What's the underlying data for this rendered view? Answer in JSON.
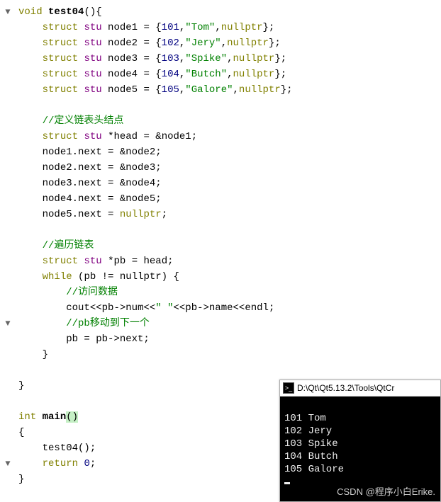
{
  "code": {
    "funcDecl": {
      "ret": "void",
      "name": "test04",
      "params": "()"
    },
    "nodes": [
      {
        "var": "node1",
        "id": "101",
        "name": "\"Tom\""
      },
      {
        "var": "node2",
        "id": "102",
        "name": "\"Jery\""
      },
      {
        "var": "node3",
        "id": "103",
        "name": "\"Spike\""
      },
      {
        "var": "node4",
        "id": "104",
        "name": "\"Butch\""
      },
      {
        "var": "node5",
        "id": "105",
        "name": "\"Galore\""
      }
    ],
    "cmt_head": "//定义链表头结点",
    "headDecl": {
      "type": "struct",
      "stype": "stu",
      "ptr": "*head",
      "assign": "= &node1;"
    },
    "links": [
      {
        "lhs": "node1.next",
        "rhs": "&node2"
      },
      {
        "lhs": "node2.next",
        "rhs": "&node3"
      },
      {
        "lhs": "node3.next",
        "rhs": "&node4"
      },
      {
        "lhs": "node4.next",
        "rhs": "&node5"
      },
      {
        "lhs": "node5.next",
        "rhs": "nullptr"
      }
    ],
    "cmt_traverse": "//遍历链表",
    "pbDecl": {
      "type": "struct",
      "stype": "stu",
      "ptr": "*pb",
      "assign": "= head;"
    },
    "whileCond": "pb != nullptr",
    "cmt_visit": "//访问数据",
    "cout_line": {
      "cout": "cout",
      "op1": "<<",
      "e1": "pb->num",
      "op2": "<<",
      "str": "\" \"",
      "op3": "<<",
      "e2": "pb->name",
      "op4": "<<",
      "endl": "endl"
    },
    "cmt_move": "//pb移动到下一个",
    "pbNext": "pb = pb->next;",
    "mainDecl": {
      "ret": "int",
      "name": "main",
      "params": "()"
    },
    "mainBody": {
      "call": "test04();",
      "ret": "return 0;"
    }
  },
  "gutter": {
    "marker": "▼"
  },
  "console": {
    "title": "D:\\Qt\\Qt5.13.2\\Tools\\QtCr",
    "lines": [
      "101 Tom",
      "102 Jery",
      "103 Spike",
      "104 Butch",
      "105 Galore"
    ]
  },
  "watermark": "CSDN @程序小白Erike."
}
